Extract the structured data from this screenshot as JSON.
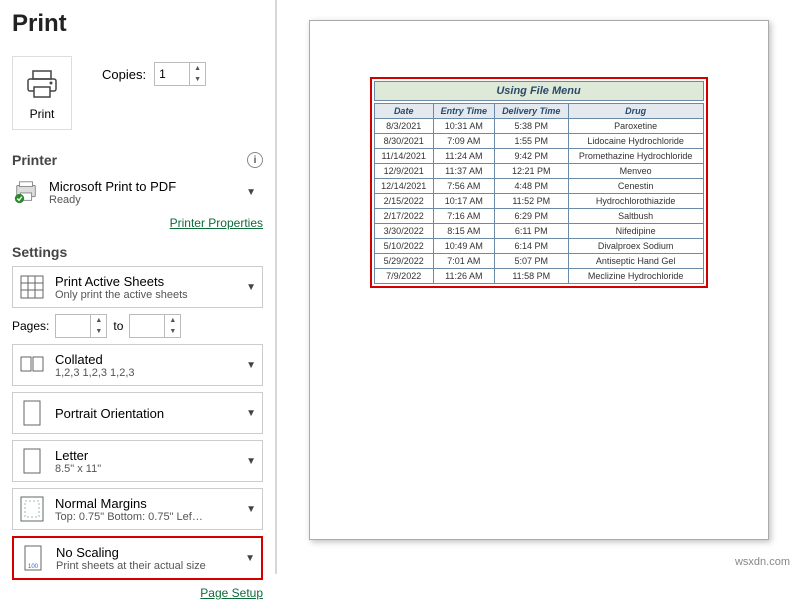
{
  "title": "Print",
  "print_button": "Print",
  "copies_label": "Copies:",
  "copies_value": "1",
  "printer_section": "Printer",
  "printer": {
    "name": "Microsoft Print to PDF",
    "status": "Ready"
  },
  "printer_properties": "Printer Properties",
  "settings_section": "Settings",
  "active_sheets": {
    "line1": "Print Active Sheets",
    "line2": "Only print the active sheets"
  },
  "pages_label": "Pages:",
  "to_label": "to",
  "collated": {
    "line1": "Collated",
    "line2": "1,2,3   1,2,3   1,2,3"
  },
  "orientation": {
    "line1": "Portrait Orientation"
  },
  "paper": {
    "line1": "Letter",
    "line2": "8.5\" x 11\""
  },
  "margins": {
    "line1": "Normal Margins",
    "line2": "Top: 0.75\" Bottom: 0.75\" Lef…"
  },
  "scaling": {
    "line1": "No Scaling",
    "line2": "Print sheets at their actual size"
  },
  "page_setup": "Page Setup",
  "preview": {
    "title": "Using File Menu",
    "headers": [
      "Date",
      "Entry Time",
      "Delivery Time",
      "Drug"
    ],
    "rows": [
      [
        "8/3/2021",
        "10:31 AM",
        "5:38 PM",
        "Paroxetine"
      ],
      [
        "8/30/2021",
        "7:09 AM",
        "1:55 PM",
        "Lidocaine Hydrochloride"
      ],
      [
        "11/14/2021",
        "11:24 AM",
        "9:42 PM",
        "Promethazine Hydrochloride"
      ],
      [
        "12/9/2021",
        "11:37 AM",
        "12:21 PM",
        "Menveo"
      ],
      [
        "12/14/2021",
        "7:56 AM",
        "4:48 PM",
        "Cenestin"
      ],
      [
        "2/15/2022",
        "10:17 AM",
        "11:52 PM",
        "Hydrochlorothiazide"
      ],
      [
        "2/17/2022",
        "7:16 AM",
        "6:29 PM",
        "Saltbush"
      ],
      [
        "3/30/2022",
        "8:15 AM",
        "6:11 PM",
        "Nifedipine"
      ],
      [
        "5/10/2022",
        "10:49 AM",
        "6:14 PM",
        "Divalproex Sodium"
      ],
      [
        "5/29/2022",
        "7:01 AM",
        "5:07 PM",
        "Antiseptic Hand Gel"
      ],
      [
        "7/9/2022",
        "11:26 AM",
        "11:58 PM",
        "Meclizine Hydrochloride"
      ]
    ]
  },
  "watermark": "wsxdn.com"
}
